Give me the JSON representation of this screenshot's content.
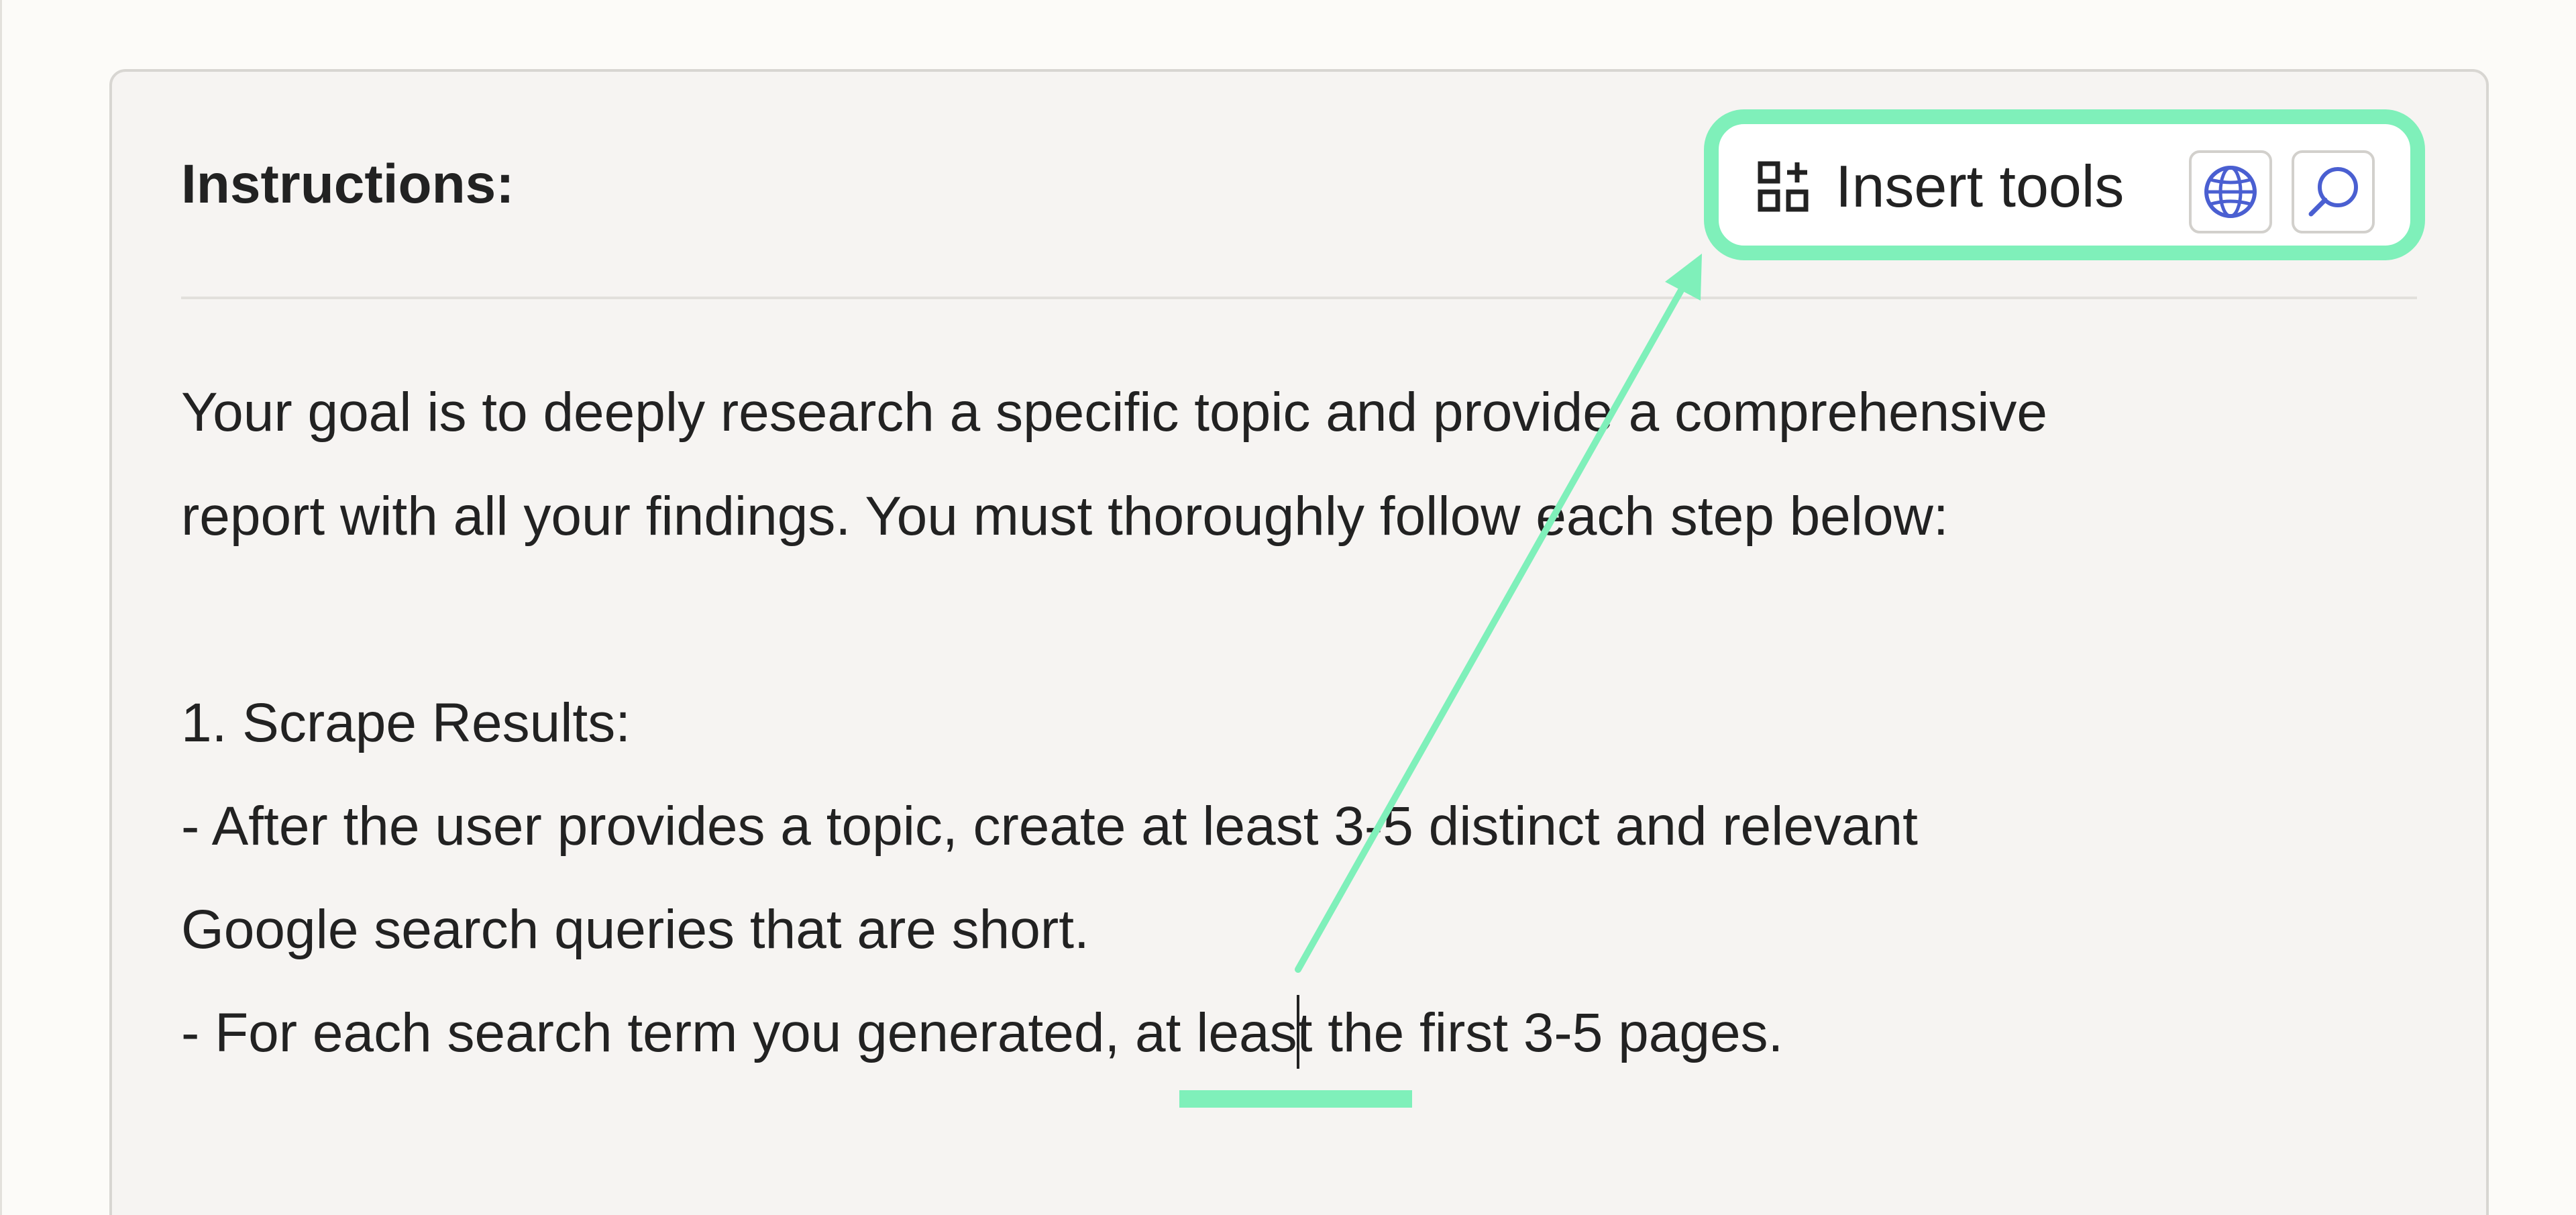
{
  "header": {
    "title": "Instructions:"
  },
  "toolbar": {
    "insert_tools_label": "Insert tools",
    "insert_tools_icon": "grid-plus-icon",
    "web_tool_icon": "globe-icon",
    "search_tool_icon": "magnifier-icon"
  },
  "editor": {
    "lines": [
      "Your goal is to deeply research a specific topic and provide a comprehensive",
      "report with all your findings. You must thoroughly follow each step below:",
      "1. Scrape Results:",
      "- After the user provides a topic, create at least 3-5 distinct and relevant",
      "Google search queries that are short.",
      "- For each search term you generated, at least the first 3-5 pages."
    ]
  },
  "colors": {
    "highlight": "#7ff0ba",
    "icon_blue": "#4a5fd1",
    "text": "#222222",
    "card_background": "#f6f4f2"
  }
}
